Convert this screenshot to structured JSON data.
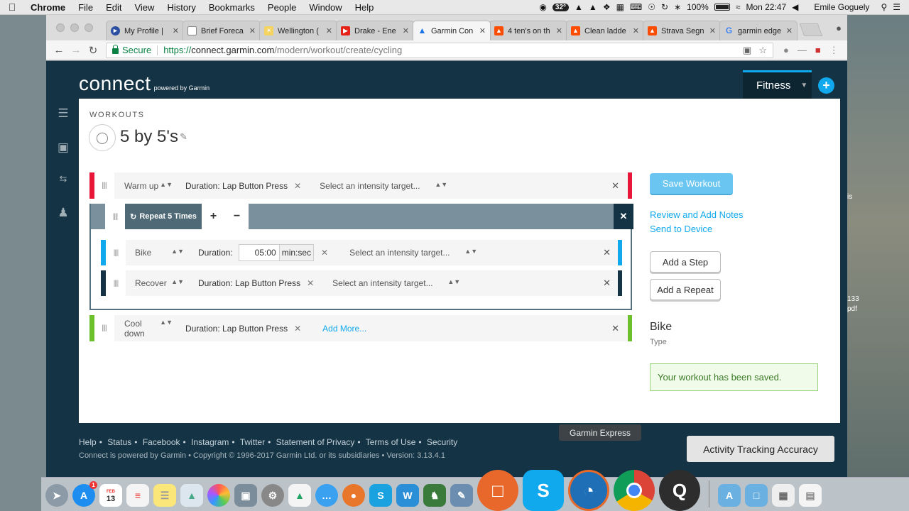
{
  "menubar": {
    "app": "Chrome",
    "items": [
      "File",
      "Edit",
      "View",
      "History",
      "Bookmarks",
      "People",
      "Window",
      "Help"
    ],
    "temp": "32°",
    "battery": "100%",
    "clock": "Mon 22:47",
    "user": "Emile Goguely"
  },
  "browser": {
    "tabs": [
      {
        "title": "My Profile |",
        "color": "#2b4fa0"
      },
      {
        "title": "Brief Foreca",
        "color": "#888888"
      },
      {
        "title": "Wellington (",
        "color": "#f4b400"
      },
      {
        "title": "Drake - Ene",
        "color": "#e62117"
      },
      {
        "title": "Garmin Con",
        "color": "#1a73e8"
      },
      {
        "title": "4 ten's on th",
        "color": "#fc4c02"
      },
      {
        "title": "Clean ladde",
        "color": "#fc4c02"
      },
      {
        "title": "Strava Segn",
        "color": "#fc4c02"
      },
      {
        "title": "garmin edge",
        "color": "#4285f4"
      }
    ],
    "secure_label": "Secure",
    "url_scheme": "https://",
    "url_host": "connect.garmin.com",
    "url_path": "/modern/workout/create/cycling"
  },
  "garmin": {
    "logo": "connect",
    "logo_sub": "powered by Garmin",
    "fitness_menu": "Fitness",
    "section_label": "WORKOUTS",
    "workout_name": "5 by 5's",
    "steps": {
      "warmup": {
        "type": "Warm up",
        "duration": "Duration: Lap Button Press",
        "intensity": "Select an intensity target...",
        "color": "#e8173a"
      },
      "repeat": {
        "title": "Repeat 5 Times",
        "plus": "+",
        "minus": "−"
      },
      "bike": {
        "type": "Bike",
        "duration_label": "Duration:",
        "duration_value": "05:00",
        "unit": "min:sec",
        "intensity": "Select an intensity target...",
        "color": "#11a9ed"
      },
      "recover": {
        "type": "Recover",
        "duration": "Duration: Lap Button Press",
        "intensity": "Select an intensity target...",
        "color": "#143345"
      },
      "cooldown": {
        "type": "Cool down",
        "duration": "Duration: Lap Button Press",
        "add_more": "Add More...",
        "color": "#6cc02b"
      }
    },
    "actions": {
      "save": "Save Workout",
      "review": "Review and Add Notes",
      "send": "Send to Device",
      "add_step": "Add a Step",
      "add_repeat": "Add a Repeat"
    },
    "info": {
      "value": "Bike",
      "label": "Type"
    },
    "saved_msg": "Your workout has been saved.",
    "footer": {
      "links": [
        "Help",
        "Status",
        "Facebook",
        "Instagram",
        "Twitter",
        "Statement of Privacy",
        "Terms of Use",
        "Security"
      ],
      "copyright": "Connect is powered by Garmin • Copyright © 1996-2017 Garmin Ltd. or its subsidiaries • Version: 3.13.4.1"
    }
  },
  "desktop": {
    "right_text_1": "is",
    "right_text_2": "133",
    "right_text_3": "pdf"
  },
  "tooltips": {
    "dock": "Garmin Express",
    "notification": "Activity Tracking Accuracy"
  },
  "dock": {
    "calendar_month": "FEB",
    "calendar_day": "13",
    "appstore_badge": "1"
  }
}
